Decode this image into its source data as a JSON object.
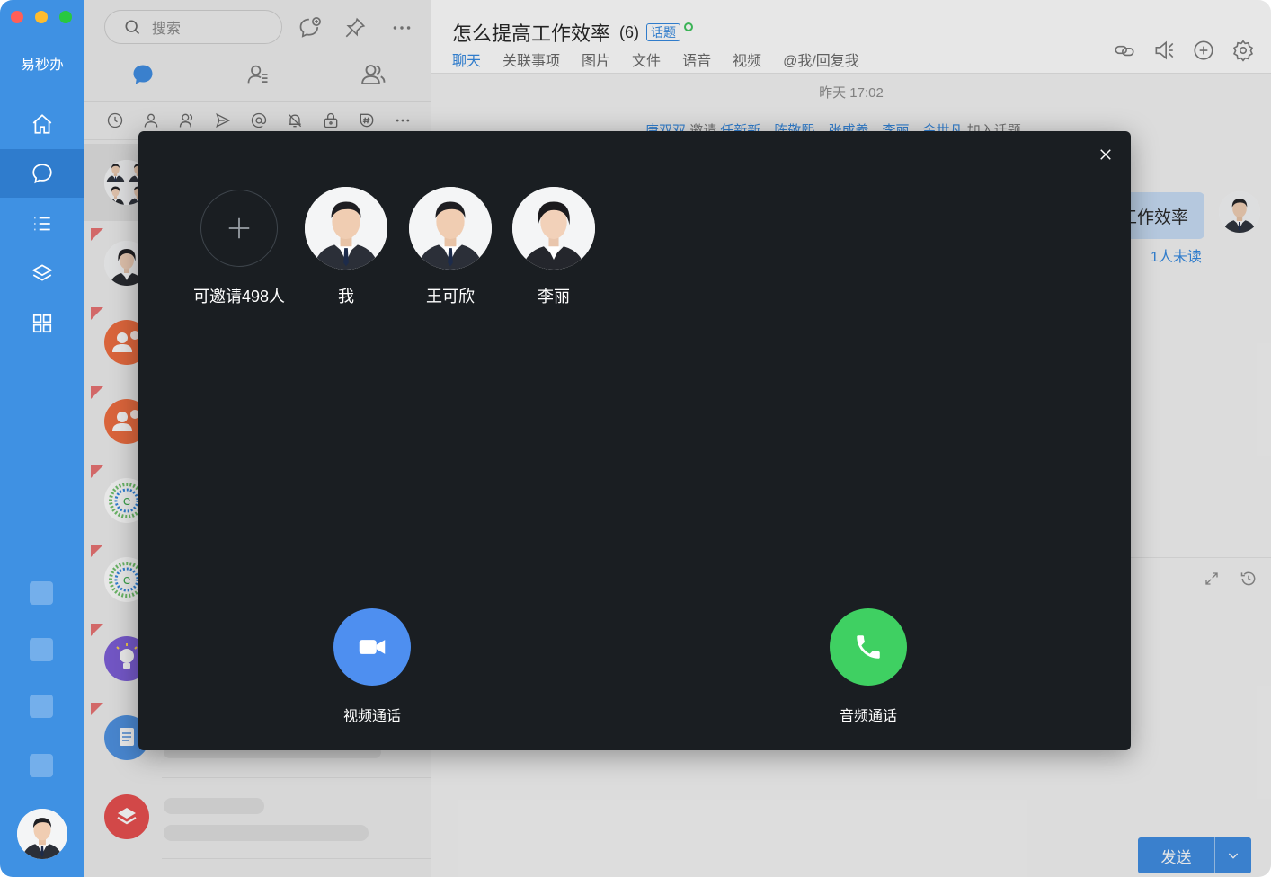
{
  "app": {
    "name": "易秒办"
  },
  "search": {
    "placeholder": "搜索"
  },
  "chat": {
    "title": "怎么提高工作效率",
    "member_count": "(6)",
    "tag": "话题",
    "tabs": [
      {
        "label": "聊天",
        "active": true
      },
      {
        "label": "关联事项"
      },
      {
        "label": "图片"
      },
      {
        "label": "文件"
      },
      {
        "label": "语音"
      },
      {
        "label": "视频"
      },
      {
        "label": "@我/回复我"
      }
    ],
    "timestamp": "昨天 17:02",
    "system_message": {
      "inviter": "唐双双",
      "verb": "邀请",
      "invitees": [
        "任新新",
        "陈敬熙",
        "张成義",
        "李丽",
        "金世凡"
      ],
      "suffix": "加入话题"
    },
    "bubble_text": "工作效率",
    "unread": "1人未读",
    "send_label": "发送"
  },
  "call_modal": {
    "invite_label": "可邀请498人",
    "members": [
      {
        "name": "我"
      },
      {
        "name": "王可欣"
      },
      {
        "name": "李丽"
      }
    ],
    "video_label": "视频通话",
    "audio_label": "音频通话",
    "video_color": "#4e8ff0",
    "audio_color": "#3fd062"
  }
}
